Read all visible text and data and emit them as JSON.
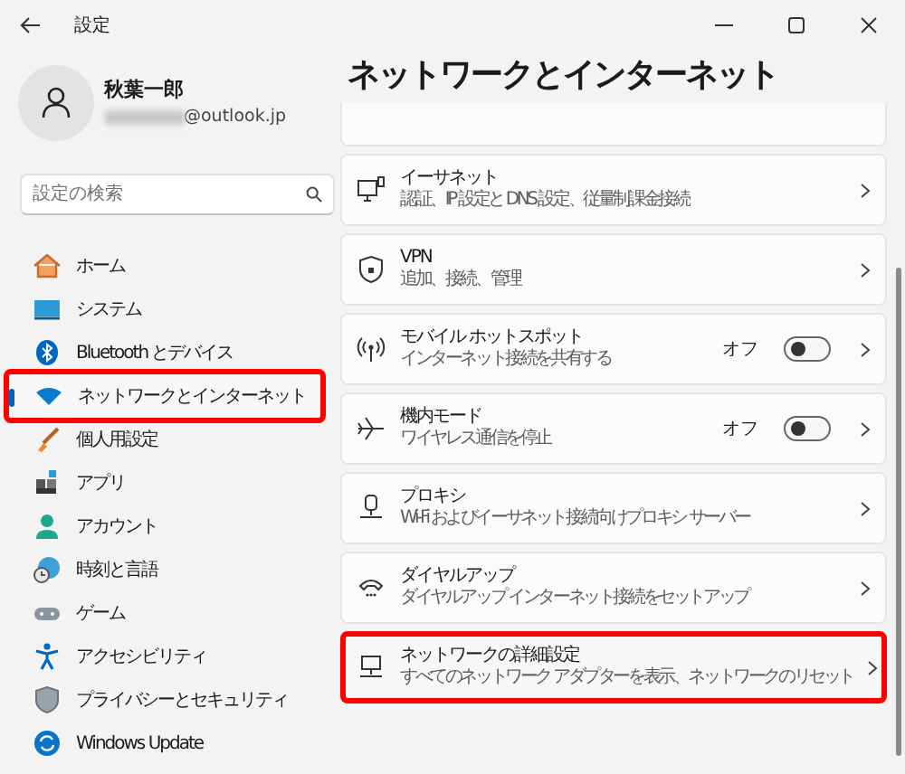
{
  "window": {
    "title": "設定"
  },
  "account": {
    "name": "秋葉一郎",
    "email": "@outlook.jp"
  },
  "search": {
    "placeholder": "設定の検索"
  },
  "sidebar": {
    "items": [
      {
        "label": "ホーム",
        "selected": false,
        "highlighted": false
      },
      {
        "label": "システム",
        "selected": false,
        "highlighted": false
      },
      {
        "label": "Bluetooth とデバイス",
        "selected": false,
        "highlighted": false
      },
      {
        "label": "ネットワークとインターネット",
        "selected": true,
        "highlighted": true
      },
      {
        "label": "個人用設定",
        "selected": false,
        "highlighted": false
      },
      {
        "label": "アプリ",
        "selected": false,
        "highlighted": false
      },
      {
        "label": "アカウント",
        "selected": false,
        "highlighted": false
      },
      {
        "label": "時刻と言語",
        "selected": false,
        "highlighted": false
      },
      {
        "label": "ゲーム",
        "selected": false,
        "highlighted": false
      },
      {
        "label": "アクセシビリティ",
        "selected": false,
        "highlighted": false
      },
      {
        "label": "プライバシーとセキュリティ",
        "selected": false,
        "highlighted": false
      },
      {
        "label": "Windows Update",
        "selected": false,
        "highlighted": false
      }
    ]
  },
  "page": {
    "title": "ネットワークとインターネット",
    "cards": [
      {
        "kind": "link",
        "title": "イーサネット",
        "subtitle": "認証、IP 設定と DNS 設定、従量制課金接続",
        "highlighted": false
      },
      {
        "kind": "link",
        "title": "VPN",
        "subtitle": "追加、接続、管理",
        "highlighted": false
      },
      {
        "kind": "toggle",
        "title": "モバイル ホットスポット",
        "subtitle": "インターネット接続を共有する",
        "state_label": "オフ",
        "on": false,
        "highlighted": false
      },
      {
        "kind": "toggle",
        "title": "機内モード",
        "subtitle": "ワイヤレス通信を停止",
        "state_label": "オフ",
        "on": false,
        "highlighted": false
      },
      {
        "kind": "link",
        "title": "プロキシ",
        "subtitle": "Wi-Fi およびイーサネット接続向けプロキシ サーバー",
        "highlighted": false
      },
      {
        "kind": "link",
        "title": "ダイヤルアップ",
        "subtitle": "ダイヤルアップ インターネット接続をセットアップ",
        "highlighted": false
      },
      {
        "kind": "link",
        "title": "ネットワークの詳細設定",
        "subtitle": "すべてのネットワーク アダプターを表示、ネットワークのリセット",
        "highlighted": true
      }
    ]
  }
}
